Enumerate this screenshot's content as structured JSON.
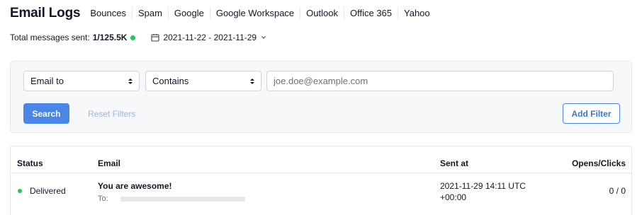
{
  "header": {
    "title": "Email Logs",
    "providers": [
      "Bounces",
      "Spam",
      "Google",
      "Google Workspace",
      "Outlook",
      "Office 365",
      "Yahoo"
    ]
  },
  "summary": {
    "total_label": "Total messages sent:",
    "total_value": "1/125.5K",
    "status_color": "#22c55e",
    "date_range": "2021-11-22 - 2021-11-29",
    "calendar_icon": "calendar-icon",
    "chevron_icon": "chevron-down-icon"
  },
  "filters": {
    "field_select": "Email to",
    "operator_select": "Contains",
    "value_placeholder": "joe.doe@example.com",
    "search_label": "Search",
    "reset_label": "Reset Filters",
    "add_filter_label": "Add Filter",
    "accent_color": "#4a86e8"
  },
  "table": {
    "headers": {
      "status": "Status",
      "email": "Email",
      "sent_at": "Sent at",
      "opens_clicks": "Opens/Clicks"
    },
    "rows": [
      {
        "status": "Delivered",
        "status_color": "#22c55e",
        "subject": "You are awesome!",
        "to_label": "To:",
        "sent_at_line1": "2021-11-29 14:11 UTC",
        "sent_at_line2": "+00:00",
        "opens_clicks": "0 / 0"
      }
    ]
  }
}
